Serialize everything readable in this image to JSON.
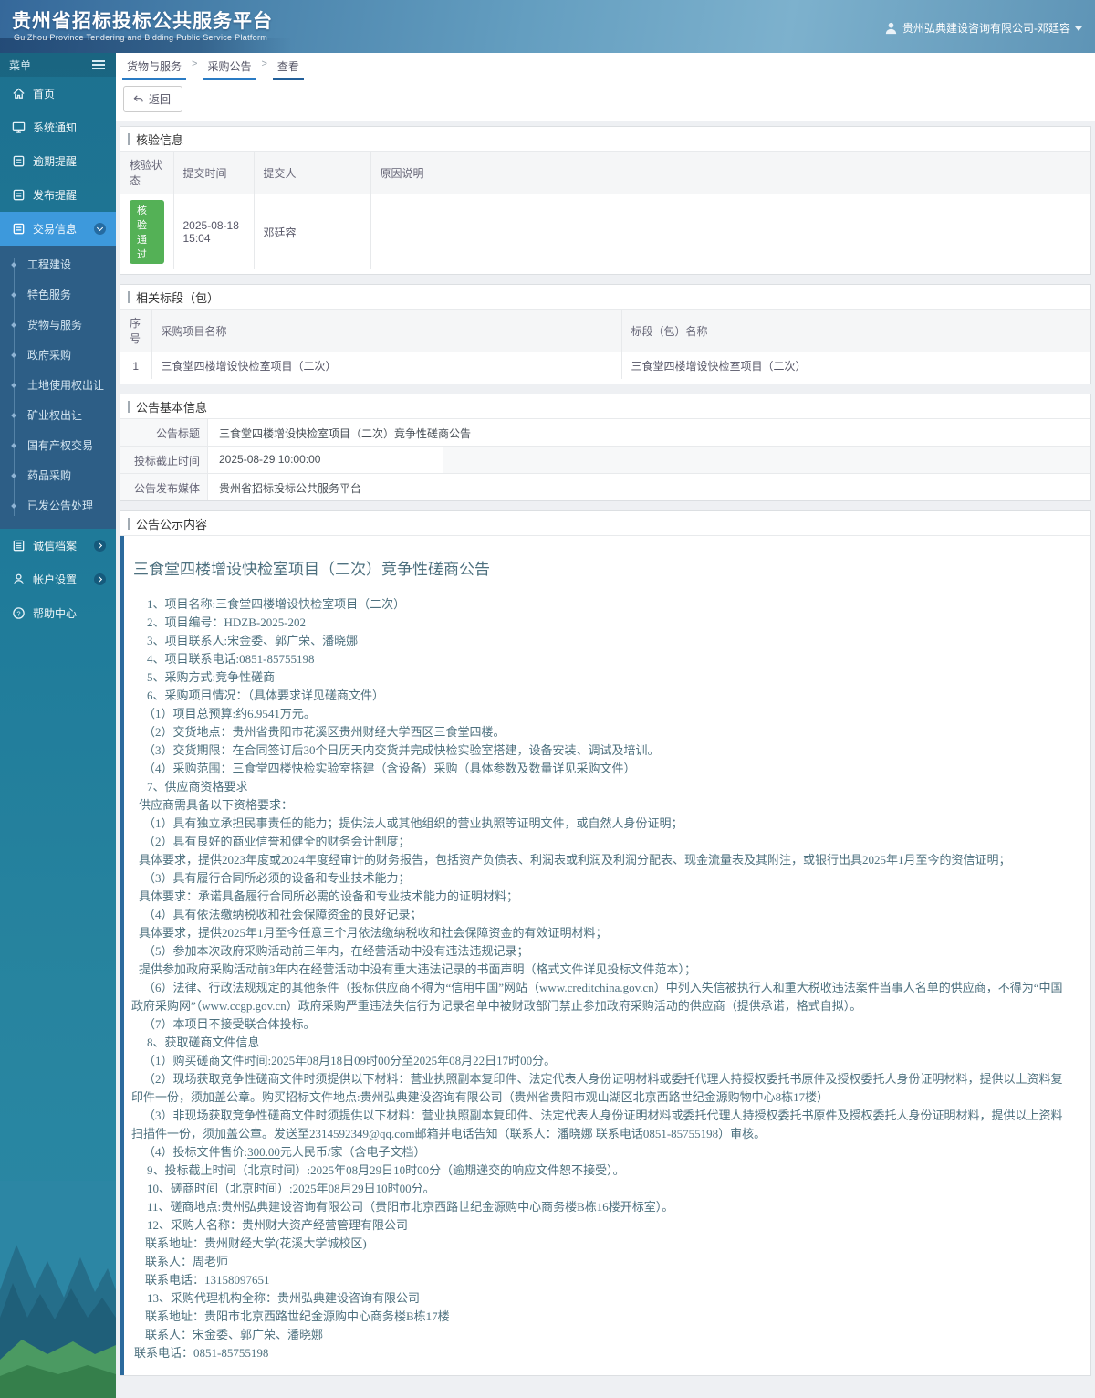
{
  "colors": {
    "header_blue": "#4a83ac",
    "sidebar_teal": "#20809f",
    "submenu_navy": "#2d5e86",
    "active_item_blue": "#3d99dc",
    "crumb_underline_blue": "#2a7bc4",
    "success_green": "#54b156",
    "content_text": "#4e717f",
    "content_accent_bar": "#2c6a9d"
  },
  "header": {
    "title": "贵州省招标投标公共服务平台",
    "subtitle": "GuiZhou Province Tendering and Bidding Public Service Platform",
    "user": "贵州弘典建设咨询有限公司-邓廷容"
  },
  "sidebar": {
    "menu_label": "菜单",
    "items": [
      {
        "label": "首页"
      },
      {
        "label": "系统通知"
      },
      {
        "label": "逾期提醒"
      },
      {
        "label": "发布提醒"
      },
      {
        "label": "交易信息",
        "active": true
      }
    ],
    "submenu": [
      "工程建设",
      "特色服务",
      "货物与服务",
      "政府采购",
      "土地使用权出让",
      "矿业权出让",
      "国有产权交易",
      "药品采购",
      "已发公告处理"
    ],
    "bottom_items": [
      {
        "label": "诚信档案"
      },
      {
        "label": "帐户设置"
      },
      {
        "label": "帮助中心"
      }
    ]
  },
  "breadcrumb": {
    "items": [
      "货物与服务",
      "采购公告",
      "查看"
    ],
    "separator": ">"
  },
  "toolbar": {
    "back_label": "返回"
  },
  "verification": {
    "section_title": "核验信息",
    "columns": [
      "核验状态",
      "提交时间",
      "提交人",
      "原因说明"
    ],
    "row": {
      "status": "核验通过",
      "time": "2025-08-18 15:04",
      "person": "邓廷容",
      "reason": ""
    }
  },
  "related": {
    "section_title": "相关标段（包）",
    "columns": [
      "序号",
      "采购项目名称",
      "标段（包）名称"
    ],
    "rows": [
      [
        "1",
        "三食堂四楼增设快检室项目（二次）",
        "三食堂四楼增设快检室项目（二次）"
      ]
    ]
  },
  "basic_info": {
    "section_title": "公告基本信息",
    "rows": [
      {
        "label": "公告标题",
        "value": "三食堂四楼增设快检室项目（二次）竞争性磋商公告"
      },
      {
        "label": "投标截止时间",
        "value": "2025-08-29 10:00:00"
      },
      {
        "label": "公告发布媒体",
        "value": "贵州省招标投标公共服务平台"
      }
    ]
  },
  "content": {
    "section_title": "公告公示内容",
    "title": "三食堂四楼增设快检室项目（二次）竞争性磋商公告",
    "paragraphs": [
      {
        "c": "i1",
        "t": "1、项目名称:三食堂四楼增设快检室项目（二次）"
      },
      {
        "c": "i1",
        "t": "2、项目编号：HDZB-2025-202"
      },
      {
        "c": "i1",
        "t": "3、项目联系人:宋金委、郭广荣、潘晓娜"
      },
      {
        "c": "i1",
        "t": "4、项目联系电话:0851-85755198"
      },
      {
        "c": "i1",
        "t": "5、采购方式:竞争性磋商"
      },
      {
        "c": "i1",
        "t": "6、采购项目情况：（具体要求详见磋商文件）"
      },
      {
        "c": "i2",
        "t": "（1）项目总预算:约6.9541万元。"
      },
      {
        "c": "i2",
        "t": "（2）交货地点：贵州省贵阳市花溪区贵州财经大学西区三食堂四楼。"
      },
      {
        "c": "i2",
        "t": "（3）交货期限：在合同签订后30个日历天内交货并完成快检实验室搭建，设备安装、调试及培训。"
      },
      {
        "c": "i2",
        "t": "（4）采购范围：三食堂四楼快检实验室搭建（含设备）采购（具体参数及数量详见采购文件）"
      },
      {
        "c": "i1",
        "t": "7、供应商资格要求"
      },
      {
        "c": "i3",
        "t": "供应商需具备以下资格要求："
      },
      {
        "c": "i2",
        "t": "（1）具有独立承担民事责任的能力；提供法人或其他组织的营业执照等证明文件，或自然人身份证明；"
      },
      {
        "c": "i2",
        "t": "（2）具有良好的商业信誉和健全的财务会计制度；"
      },
      {
        "c": "i3",
        "t": "具体要求，提供2023年度或2024年度经审计的财务报告，包括资产负债表、利润表或利润及利润分配表、现金流量表及其附注，或银行出具2025年1月至今的资信证明；"
      },
      {
        "c": "i2",
        "t": "（3）具有履行合同所必须的设备和专业技术能力；"
      },
      {
        "c": "i3",
        "t": "具体要求：承诺具备履行合同所必需的设备和专业技术能力的证明材料；"
      },
      {
        "c": "i2",
        "t": "（4）具有依法缴纳税收和社会保障资金的良好记录；"
      },
      {
        "c": "i3",
        "t": "具体要求，提供2025年1月至今任意三个月依法缴纳税收和社会保障资金的有效证明材料；"
      },
      {
        "c": "i2",
        "t": "（5）参加本次政府采购活动前三年内，在经营活动中没有违法违规记录；"
      },
      {
        "c": "i3",
        "t": "提供参加政府采购活动前3年内在经营活动中没有重大违法记录的书面声明（格式文件详见投标文件范本）；"
      },
      {
        "c": "i2",
        "t": "（6）法律、行政法规规定的其他条件（投标供应商不得为“信用中国”网站（www.creditchina.gov.cn）中列入失信被执行人和重大税收违法案件当事人名单的供应商，不得为“中国政府采购网”（www.ccgp.gov.cn）政府采购严重违法失信行为记录名单中被财政部门禁止参加政府采购活动的供应商（提供承诺，格式自拟）。"
      },
      {
        "c": "i2",
        "t": "（7）本项目不接受联合体投标。"
      },
      {
        "c": "i1",
        "t": "8、获取磋商文件信息"
      },
      {
        "c": "i2",
        "t": "（1）购买磋商文件时间:2025年08月18日09时00分至2025年08月22日17时00分。"
      },
      {
        "c": "i2",
        "t": "（2）现场获取竞争性磋商文件时须提供以下材料：营业执照副本复印件、法定代表人身份证明材料或委托代理人持授权委托书原件及授权委托人身份证明材料，提供以上资料复印件一份，须加盖公章。购买招标文件地点:贵州弘典建设咨询有限公司（贵州省贵阳市观山湖区北京西路世纪金源购物中心8栋17楼）"
      },
      {
        "c": "i2",
        "t": "（3）非现场获取竞争性磋商文件时须提供以下材料：营业执照副本复印件、法定代表人身份证明材料或委托代理人持授权委托书原件及授权委托人身份证明材料，提供以上资料扫描件一份，须加盖公章。发送至2314592349@qq.com邮箱并电话告知（联系人：潘晓娜 联系电话0851-85755198）审核。"
      },
      {
        "c": "i2",
        "t": "（4）投标文件售价:300.00元人民币/家（含电子文档）",
        "u": "300.00"
      },
      {
        "c": "i1",
        "t": "9、投标截止时间（北京时间）:2025年08月29日10时00分（逾期递交的响应文件恕不接受）。"
      },
      {
        "c": "i1",
        "t": "10、磋商时间（北京时间）:2025年08月29日10时00分。"
      },
      {
        "c": "i1",
        "t": "11、磋商地点:贵州弘典建设咨询有限公司（贵阳市北京西路世纪金源购中心商务楼B栋16楼开标室）。"
      },
      {
        "c": "i1",
        "t": "12、采购人名称：贵州财大资产经营管理有限公司"
      },
      {
        "c": "i4",
        "t": "联系地址：贵州财经大学(花溪大学城校区)"
      },
      {
        "c": "i4",
        "t": "联系人：周老师"
      },
      {
        "c": "i4",
        "t": "联系电话：13158097651"
      },
      {
        "c": "i1",
        "t": "13、采购代理机构全称：贵州弘典建设咨询有限公司"
      },
      {
        "c": "i4",
        "t": "联系地址：贵阳市北京西路世纪金源购中心商务楼B栋17楼"
      },
      {
        "c": "i4",
        "t": "联系人：宋金委、郭广荣、潘晓娜"
      },
      {
        "c": "i5",
        "t": "联系电话：0851-85755198"
      }
    ]
  }
}
